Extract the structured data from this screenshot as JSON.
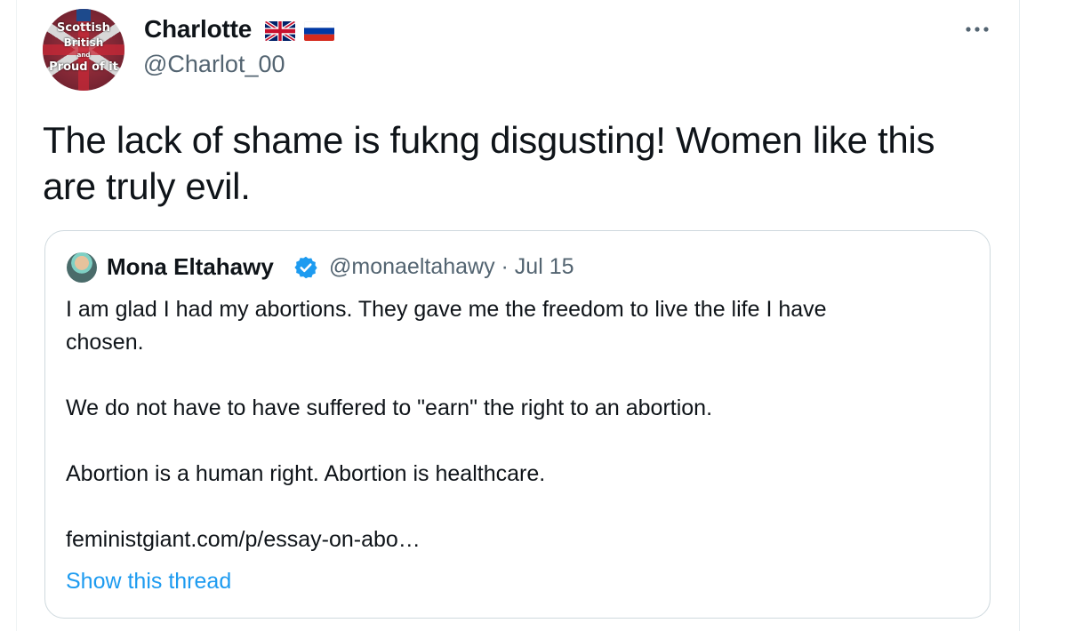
{
  "tweet": {
    "author_name": "Charlotte",
    "author_handle": "@Charlot_00",
    "avatar_text": [
      "Scottish",
      "British",
      "and",
      "Proud of it"
    ],
    "text_line1": "The lack of shame is fukng disgusting! Women like this",
    "text_line2": "are truly evil.",
    "flags": [
      "flag-uk-icon",
      "flag-russia-icon"
    ],
    "more_icon": "more-horizontal-icon"
  },
  "quoted_tweet": {
    "author_name": "Mona Eltahawy",
    "verified_icon": "verified-badge-icon",
    "handle_date": "@monaeltahawy · Jul 15",
    "line1": "I am glad I had my abortions. They gave me the freedom to live the life I have",
    "line2": "chosen.",
    "line3": "We do not have to have suffered to \"earn\" the right to an abortion.",
    "line4": "Abortion is a human right. Abortion is healthcare.",
    "line5": "feministgiant.com/p/essay-on-abo…",
    "show_thread": "Show this thread"
  },
  "colors": {
    "text": "#0f1419",
    "secondary": "#536471",
    "link": "#1d9bf0",
    "border": "#cfd9de"
  }
}
